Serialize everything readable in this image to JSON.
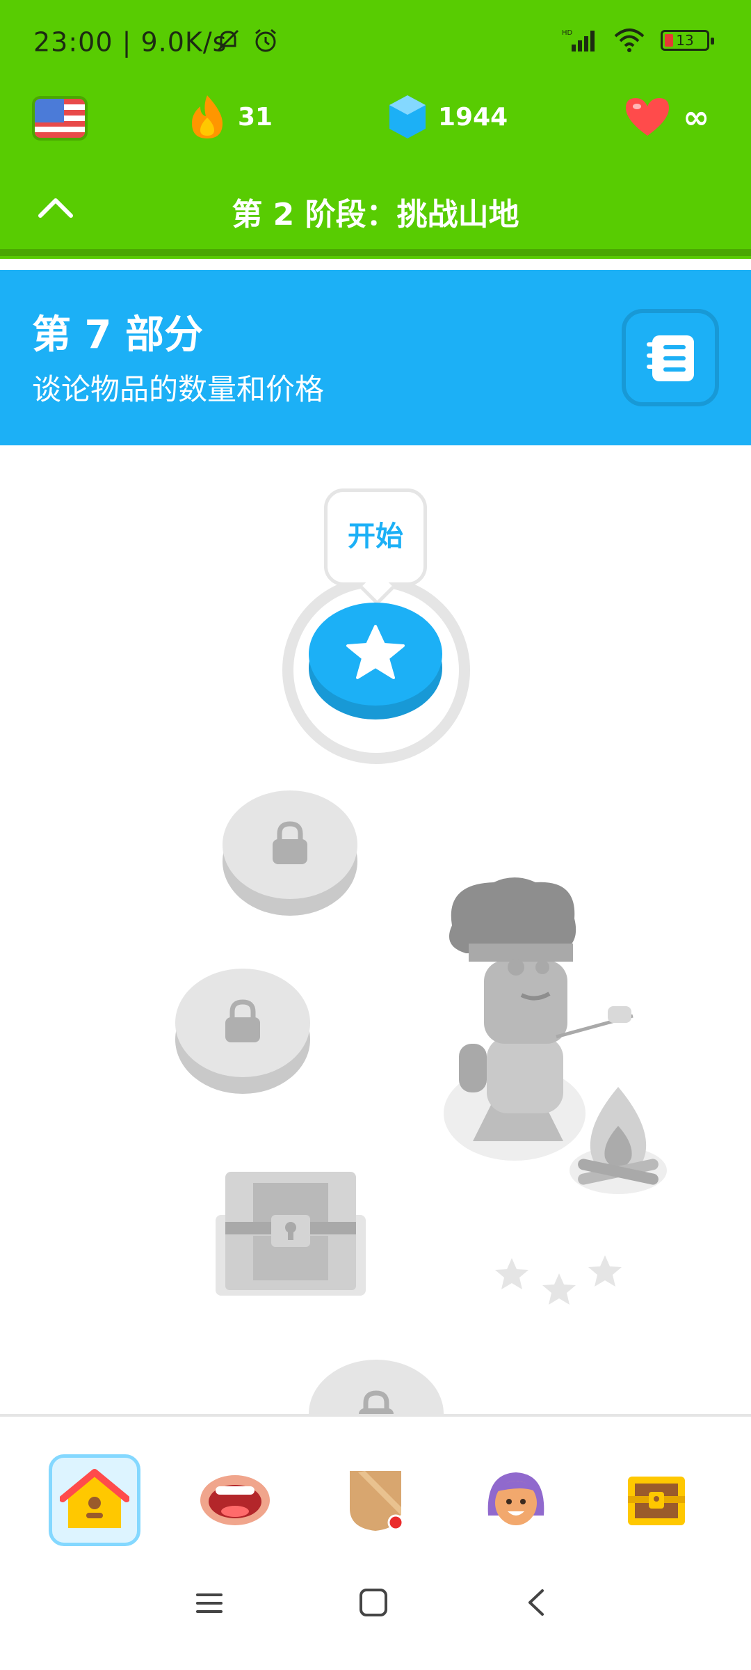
{
  "status_bar": {
    "time": "23:00",
    "speed": "9.0K/s",
    "battery": "13",
    "network": "HD"
  },
  "stats": {
    "streak": "31",
    "gems": "1944",
    "hearts": "∞"
  },
  "stage_title": "第 2 阶段：挑战山地",
  "unit": {
    "title": "第 7 部分",
    "subtitle": "谈论物品的数量和价格"
  },
  "path": {
    "start_label": "开始"
  },
  "colors": {
    "header_green": "#58cc02",
    "unit_blue": "#1cb0f6",
    "locked_gray": "#e5e5e5"
  },
  "bottom_nav": [
    {
      "icon": "home-icon",
      "active": true
    },
    {
      "icon": "speaking-mouth-icon",
      "active": false
    },
    {
      "icon": "league-shield-icon",
      "active": false
    },
    {
      "icon": "profile-avatar-icon",
      "active": false
    },
    {
      "icon": "treasure-chest-icon",
      "active": false
    }
  ]
}
